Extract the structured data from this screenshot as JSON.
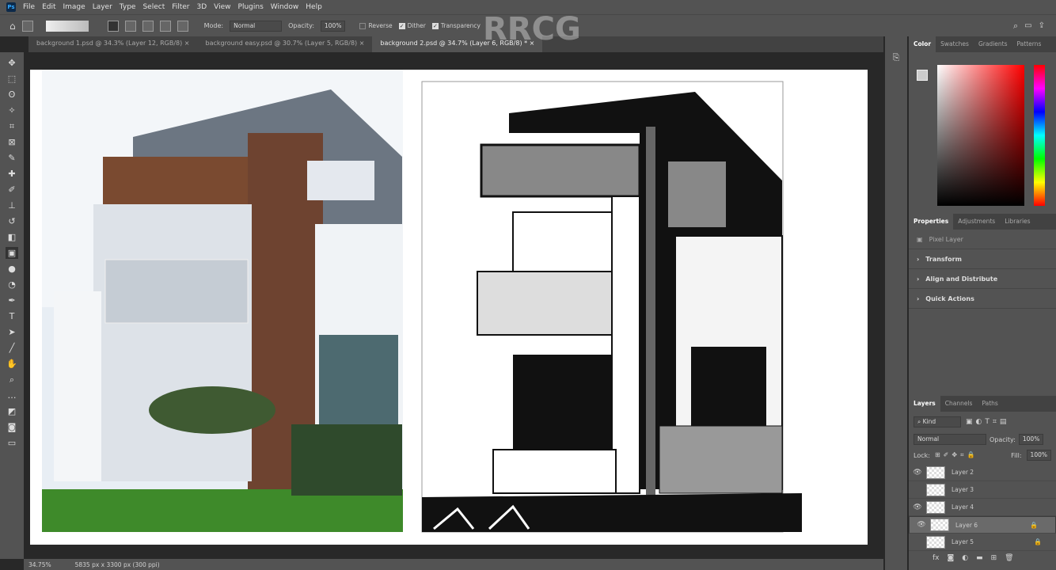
{
  "menu": [
    "File",
    "Edit",
    "Image",
    "Layer",
    "Type",
    "Select",
    "Filter",
    "3D",
    "View",
    "Plugins",
    "Window",
    "Help"
  ],
  "options": {
    "mode_label": "Mode:",
    "mode_value": "Normal",
    "opacity_label": "Opacity:",
    "opacity_value": "100%",
    "reverse": "Reverse",
    "dither": "Dither",
    "transparency": "Transparency"
  },
  "tabs": [
    "background 1.psd @ 34.3% (Layer 12, RGB/8)",
    "background easy.psd @ 30.7% (Layer 5, RGB/8)",
    "background 2.psd @ 34.7% (Layer 6, RGB/8) *"
  ],
  "color_panel": {
    "tabs": [
      "Color",
      "Swatches",
      "Gradients",
      "Patterns"
    ]
  },
  "properties": {
    "tabs": [
      "Properties",
      "Adjustments",
      "Libraries"
    ],
    "kind": "Pixel Layer",
    "sections": [
      "Transform",
      "Align and Distribute",
      "Quick Actions"
    ]
  },
  "layers_panel": {
    "tabs": [
      "Layers",
      "Channels",
      "Paths"
    ],
    "filter": "Kind",
    "blend": "Normal",
    "opacity_label": "Opacity:",
    "opacity": "100%",
    "lock_label": "Lock:",
    "fill_label": "Fill:",
    "fill": "100%",
    "layers": [
      {
        "name": "Layer 2",
        "visible": true
      },
      {
        "name": "Layer 3",
        "visible": false
      },
      {
        "name": "Layer 4",
        "visible": true
      },
      {
        "name": "Layer 6",
        "visible": true,
        "selected": true
      },
      {
        "name": "Layer 5",
        "visible": false
      }
    ]
  },
  "status": {
    "zoom": "34.75%",
    "doc": "5835 px x 3300 px (300 ppi)"
  },
  "watermark": "RRCG"
}
